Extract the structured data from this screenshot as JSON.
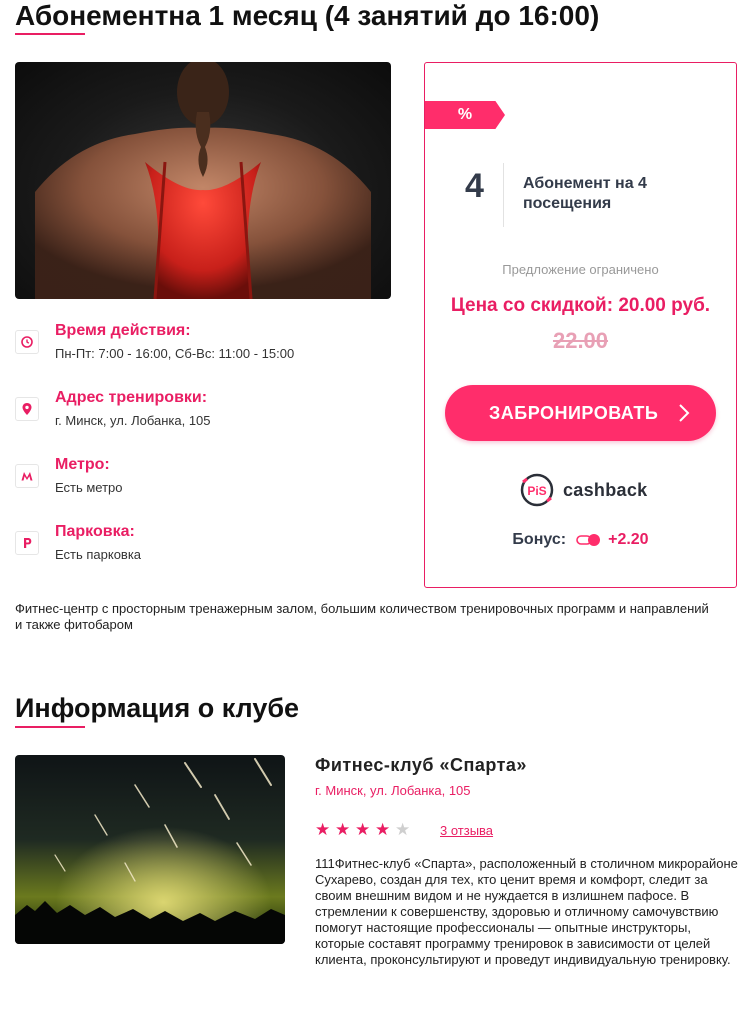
{
  "page": {
    "title": "Абонементна 1 месяц (4 занятий до 16:00)",
    "accent_color": "#e91e63"
  },
  "hero": {
    "image_subject": "woman-back-red-tank-top"
  },
  "info": [
    {
      "icon": "clock-icon",
      "label": "Время действия:",
      "value": "Пн-Пт: 7:00 - 16:00, Сб-Вс: 11:00 - 15:00"
    },
    {
      "icon": "location-pin-icon",
      "label": "Адрес тренировки:",
      "value": "г. Минск, ул. Лобанка, 105"
    },
    {
      "icon": "metro-icon",
      "label": "Метро:",
      "value": "Есть метро"
    },
    {
      "icon": "parking-icon",
      "label": "Парковка:",
      "value": "Есть парковка"
    }
  ],
  "card": {
    "discount_tag": "%",
    "count": "4",
    "count_label": "Абонемент на 4 посещения",
    "limited_text": "Предложение ограничено",
    "price_discount": "Цена со скидкой: 20.00 руб.",
    "price_old": "22.00",
    "book_button": "ЗАБРОНИРОВАТЬ",
    "cashback_badge": "PiS",
    "cashback_text": "cashback",
    "bonus_label": "Бонус:",
    "bonus_value": "+2.20"
  },
  "description": "Фитнес-центр с просторным тренажерным залом, большим количеством тренировочных программ и направлений и также фитобаром",
  "club_section": {
    "title": "Информация о клубе",
    "name": "Фитнес-клуб «Спарта»",
    "address": "г. Минск, ул. Лобанка, 105",
    "rating": 4,
    "rating_max": 5,
    "reviews": "3 отзыва",
    "description": "111Фитнес-клуб «Спарта», расположенный в столичном микрорайоне Сухарево, создан для тех, кто ценит время и комфорт, следит за своим внешним видом и не нуждается в излишнем пафосе. В стремлении к совершенству, здоровью и отличному самочувствию помогут настоящие профессионалы — опытные инструкторы, которые составят программу тренировок в зависимости от целей клиента, проконсультируют и проведут индивидуальную тренировку."
  }
}
